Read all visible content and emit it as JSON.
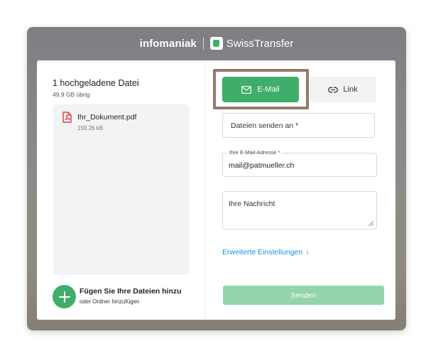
{
  "brand": {
    "company": "infomaniak",
    "product": "SwissTransfer",
    "logo_icon": "swisstransfer-logo-icon"
  },
  "upload": {
    "title": "1 hochgeladene Datei",
    "storage_left": "49.9 GB übrig",
    "files": [
      {
        "name": "Ihr_Dokument.pdf",
        "size": "159.26 kB",
        "icon": "pdf-file-icon"
      }
    ],
    "add_title": "Fügen Sie Ihre Dateien hinzu",
    "add_subtitle": "oder Ordner hinzufügen",
    "add_icon": "plus-icon"
  },
  "tabs": [
    {
      "label": "E-Mail",
      "icon": "mail-icon",
      "active": true
    },
    {
      "label": "Link",
      "icon": "link-icon",
      "active": false
    }
  ],
  "form": {
    "recipients_placeholder": "Dateien senden an *",
    "email_label": "Ihre E-Mail-Adresse *",
    "email_value": "mail@patmueller.ch",
    "message_placeholder": "Ihre Nachricht",
    "advanced_settings": "Erweiterte Einstellungen",
    "send_label": "Senden"
  },
  "colors": {
    "accent": "#3fae6a",
    "accent_disabled": "#92d4ac",
    "link": "#1a8fe3",
    "highlight_border": "#93796c"
  }
}
